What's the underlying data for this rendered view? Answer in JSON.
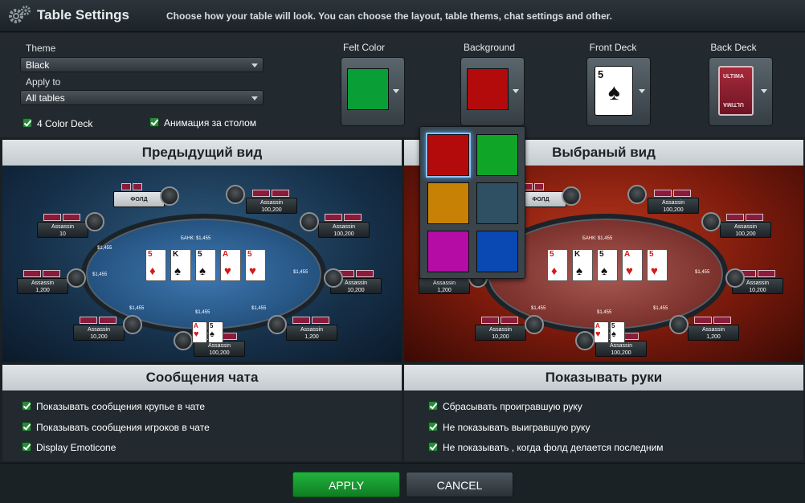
{
  "header": {
    "title": "Table Settings",
    "description": "Choose how your table will look. You can choose the layout,  table thems, chat settings and other."
  },
  "settings": {
    "theme_label": "Theme",
    "theme_value": "Black",
    "apply_label": "Apply to",
    "apply_value": "All tables",
    "four_color_label": "4 Color Deck",
    "four_color_checked": true,
    "animation_label": "Анимация за столом",
    "animation_checked": true
  },
  "swatches": {
    "felt_label": "Felt Color",
    "felt_color": "#0a9e36",
    "background_label": "Background",
    "background_color": "#b30b0b",
    "front_label": "Front Deck",
    "front_card": "5",
    "back_label": "Back Deck",
    "back_text_top": "ULTIMA",
    "back_text_bottom": "ULTIMA"
  },
  "color_popup": {
    "options": [
      "#b30b0b",
      "#0fa527",
      "#c78205",
      "#2f4f63",
      "#b50ca6",
      "#0a48b4"
    ],
    "selected": 0
  },
  "previews": {
    "previous_title": "Предыдущий вид",
    "selected_title": "Выбраный вид",
    "seat_fold": "ФОЛД",
    "bank": "БАНК: $1,455",
    "chip_amount": "$1,455",
    "seats": [
      {
        "name": "Assassin",
        "stack": "100,200"
      },
      {
        "name": "Assassin",
        "stack": "10"
      },
      {
        "name": "Assassin",
        "stack": "100,200"
      },
      {
        "name": "Assassin",
        "stack": "1,200"
      },
      {
        "name": "Assassin",
        "stack": "10,200"
      },
      {
        "name": "Assassin",
        "stack": "10,200"
      },
      {
        "name": "Assassin",
        "stack": "1,200"
      },
      {
        "name": "Assassin",
        "stack": "100,200"
      }
    ],
    "board": [
      {
        "rank": "5",
        "suit": "♦",
        "color": "red"
      },
      {
        "rank": "K",
        "suit": "♠",
        "color": "black"
      },
      {
        "rank": "5",
        "suit": "♠",
        "color": "black"
      },
      {
        "rank": "A",
        "suit": "♥",
        "color": "red"
      },
      {
        "rank": "5",
        "suit": "♥",
        "color": "red"
      }
    ],
    "hole": [
      {
        "rank": "A",
        "suit": "♥"
      },
      {
        "rank": "5",
        "suit": "♠"
      }
    ]
  },
  "chat": {
    "title": "Сообщения чата",
    "options": [
      "Показывать сообщения крупье в чате",
      "Показывать сообщения игроков в чате",
      "Display Emoticone"
    ]
  },
  "hands": {
    "title": "Показывать руки",
    "options": [
      "Сбрасывать проигравшую руку",
      "Не показывать выигравшую руку",
      "Не показывать , когда фолд делается последним"
    ]
  },
  "footer": {
    "apply": "APPLY",
    "cancel": "CANCEL"
  },
  "icons": [
    "gear-icon",
    "dropdown-arrow-icon",
    "checkmark-icon",
    "spade-icon"
  ],
  "colors": {
    "accent_green": "#1aa33a",
    "panel": "#222a2f",
    "header_bg": "#d5dadd"
  }
}
